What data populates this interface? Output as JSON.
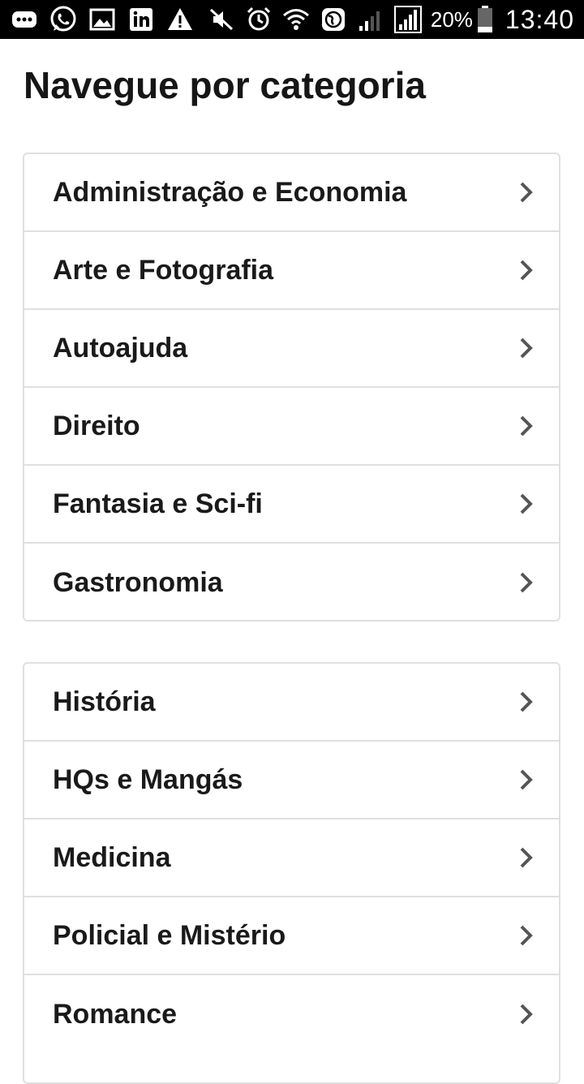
{
  "status_bar": {
    "left_icons": [
      "chat-bubble-icon",
      "whatsapp-icon",
      "gallery-icon",
      "linkedin-icon",
      "warning-icon"
    ],
    "right_icons": [
      "mute-icon",
      "alarm-icon",
      "wifi-icon",
      "vpn-globe-icon",
      "signal-weak-icon",
      "signal-full-icon"
    ],
    "battery_percent": "20%",
    "time": "13:40"
  },
  "page": {
    "title": "Navegue por categoria"
  },
  "categories": {
    "group_1": [
      "Administração e Economia",
      "Arte e Fotografia",
      "Autoajuda",
      "Direito",
      "Fantasia e Sci-fi",
      "Gastronomia"
    ],
    "group_2": [
      "História",
      "HQs e Mangás",
      "Medicina",
      "Policial e Mistério",
      "Romance"
    ]
  },
  "colors": {
    "status_bar_bg": "#000000",
    "title_text": "#161616",
    "item_text": "#1a1a1a",
    "border": "#e0e0e0",
    "chevron": "#555555"
  }
}
